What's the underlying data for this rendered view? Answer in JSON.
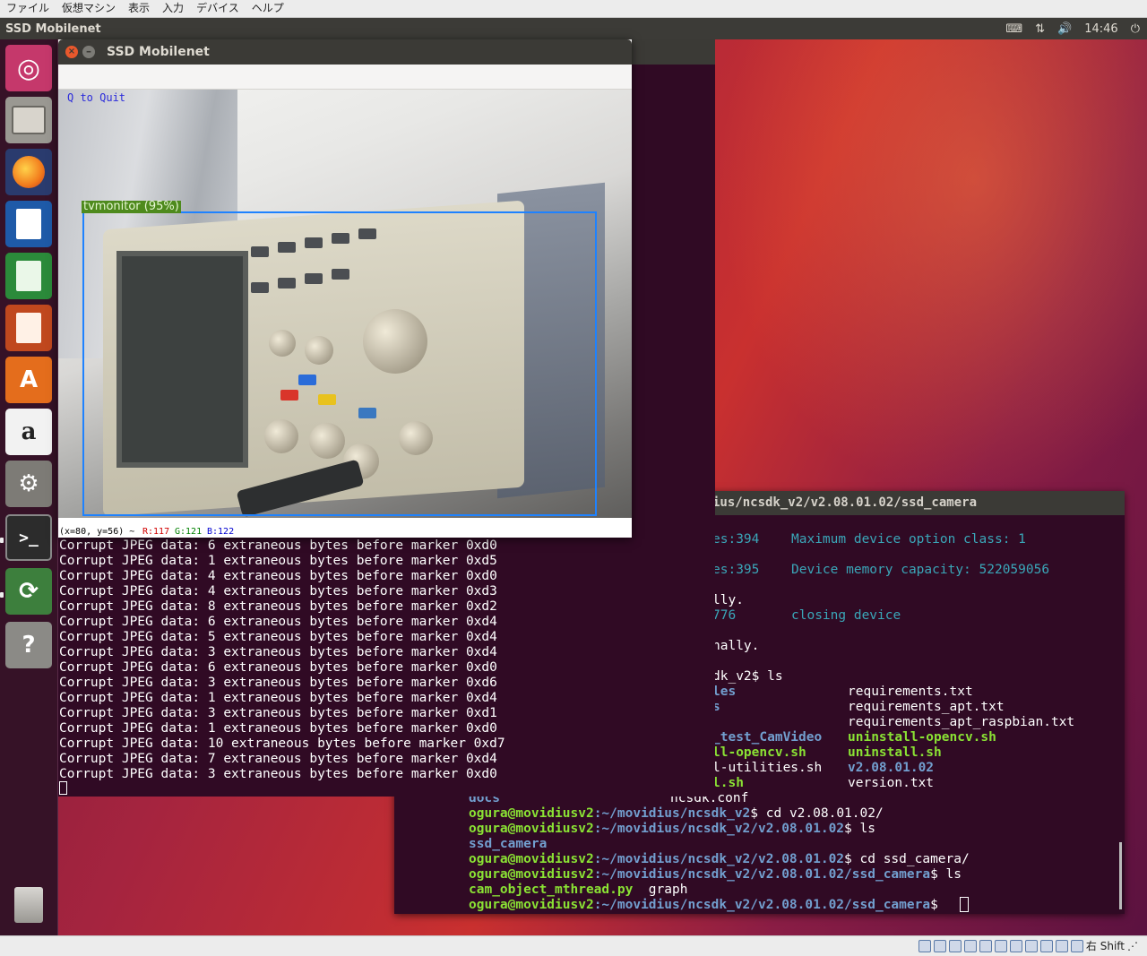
{
  "vbox_menu": [
    "ファイル",
    "仮想マシン",
    "表示",
    "入力",
    "デバイス",
    "ヘルプ"
  ],
  "top_panel": {
    "title": "SSD Mobilenet",
    "time": "14:46",
    "icons": [
      "keyboard-icon",
      "network-icon",
      "volume-icon",
      "power-icon"
    ]
  },
  "launcher": [
    "ubuntu-dash-icon",
    "files-icon",
    "firefox-icon",
    "writer-icon",
    "calc-icon",
    "impress-icon",
    "software-center-icon",
    "amazon-icon",
    "system-settings-icon",
    "terminal-icon",
    "software-updater-icon",
    "help-icon",
    "trash-icon"
  ],
  "camera": {
    "title": "SSD Mobilenet",
    "quit_hint": "Q to Quit",
    "detection": {
      "label": "tvmonitor (95%)"
    },
    "status": {
      "coords": "(x=80, y=56) ~",
      "r": "R:117",
      "g": "G:121",
      "b": "B:122"
    }
  },
  "front_terminal": {
    "lines": [
      "Corrupt JPEG data: 6 extraneous bytes before marker 0xd0",
      "Corrupt JPEG data: 1 extraneous bytes before marker 0xd5",
      "Corrupt JPEG data: 4 extraneous bytes before marker 0xd0",
      "Corrupt JPEG data: 4 extraneous bytes before marker 0xd3",
      "Corrupt JPEG data: 8 extraneous bytes before marker 0xd2",
      "Corrupt JPEG data: 6 extraneous bytes before marker 0xd4",
      "Corrupt JPEG data: 5 extraneous bytes before marker 0xd4",
      "Corrupt JPEG data: 3 extraneous bytes before marker 0xd4",
      "Corrupt JPEG data: 6 extraneous bytes before marker 0xd0",
      "Corrupt JPEG data: 3 extraneous bytes before marker 0xd6",
      "Corrupt JPEG data: 1 extraneous bytes before marker 0xd4",
      "Corrupt JPEG data: 3 extraneous bytes before marker 0xd1",
      "Corrupt JPEG data: 1 extraneous bytes before marker 0xd0",
      "Corrupt JPEG data: 10 extraneous bytes before marker 0xd7",
      "Corrupt JPEG data: 7 extraneous bytes before marker 0xd4",
      "Corrupt JPEG data: 3 extraneous bytes before marker 0xd0"
    ]
  },
  "back_terminal": {
    "title": "ius/ncsdk_v2/v2.08.01.02/ssd_camera",
    "partial": {
      "a1": "es:394",
      "a2": "Maximum device option class: 1",
      "b1": "es:395",
      "b2": "Device memory capacity: 522059056",
      "c1": "lly.",
      "d1": "776",
      "d2": "closing device",
      "e1": "nally.",
      "f1": "dk_v2$ ls",
      "g1": "les",
      "g2": "requirements.txt",
      "h1": "s",
      "h2": "requirements_apt.txt",
      "i2": "requirements_apt_raspbian.txt",
      "j1": "_test_CamVideo",
      "j2": "uninstall-opencv.sh",
      "k1": "ll-opencv.sh",
      "k2": "uninstall.sh",
      "l1": "l-utilities.sh",
      "l2": "v2.08.01.02",
      "m1": "l.sh",
      "m2": "version.txt",
      "n1": "docs",
      "n2": "ncsdk.conf"
    },
    "prompt_user": "ogura@movidiusv2",
    "p1_path": ":~/movidius/ncsdk_v2",
    "p1_cmd": "$ cd v2.08.01.02/",
    "p2_path": ":~/movidius/ncsdk_v2/v2.08.01.02",
    "p2_cmd": "$ ls",
    "out1": "ssd_camera",
    "p3_path": ":~/movidius/ncsdk_v2/v2.08.01.02",
    "p3_cmd": "$ cd ssd_camera/",
    "p4_path": ":~/movidius/ncsdk_v2/v2.08.01.02/ssd_camera",
    "p4_cmd": "$ ls",
    "out2a": "cam_object_mthread.py",
    "out2b": "graph",
    "p5_path": ":~/movidius/ncsdk_v2/v2.08.01.02/ssd_camera",
    "p5_cmd": "$ "
  },
  "statusbar": {
    "host_key": "右 Shift"
  }
}
